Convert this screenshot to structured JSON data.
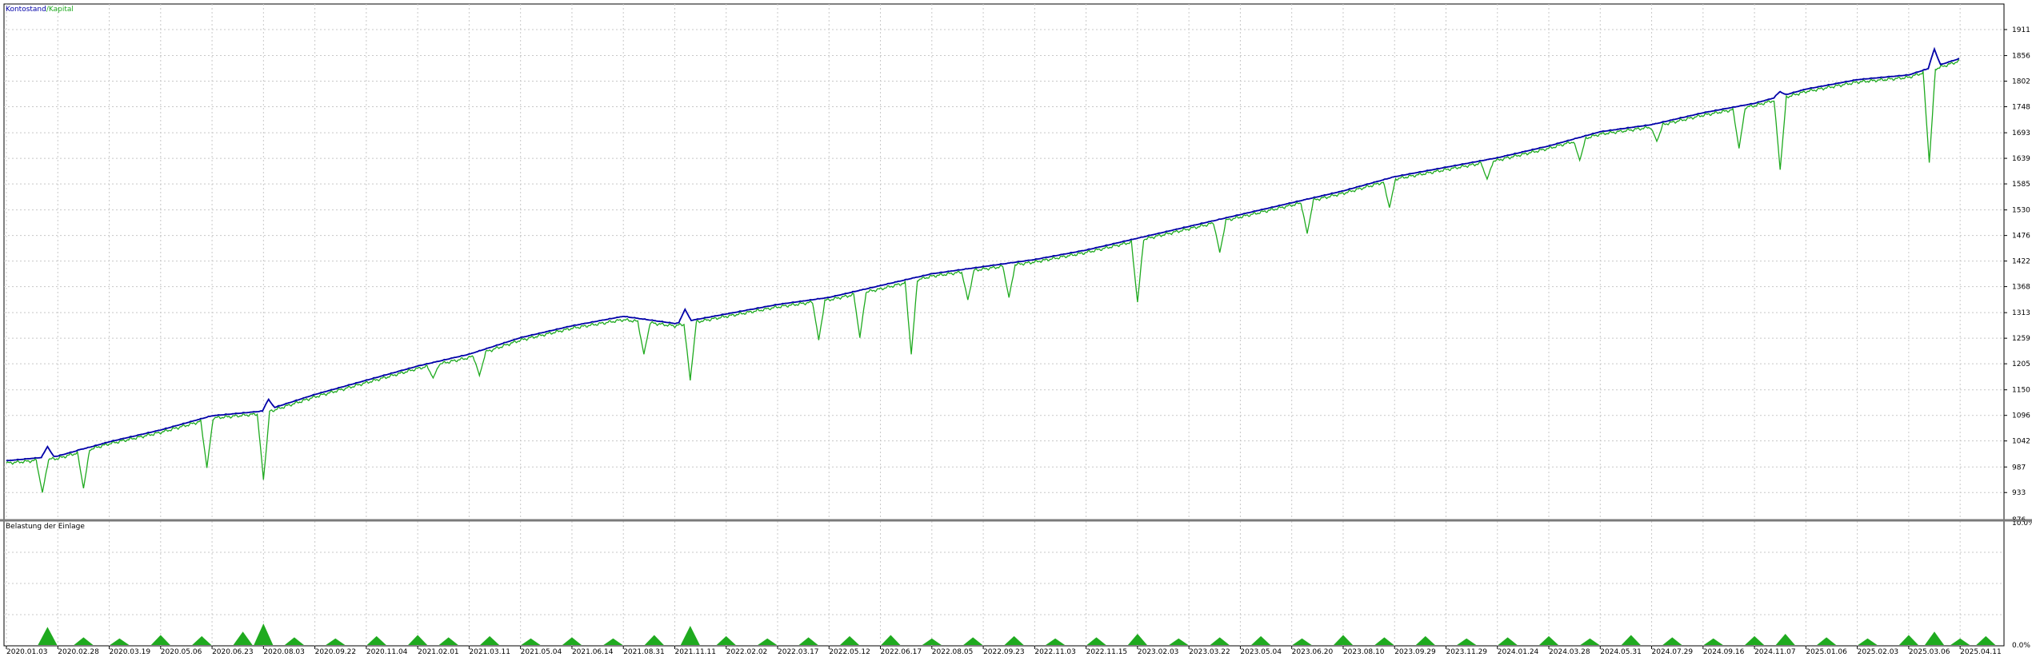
{
  "chart_data": [
    {
      "type": "line",
      "legend": [
        {
          "label": "Kontostand",
          "color": "#0000a8"
        },
        {
          "label": "Kapital",
          "color": "#1faa1f"
        }
      ],
      "legend_separator": " / ",
      "ylim": [
        876,
        1965
      ],
      "y_ticks": [
        876,
        933,
        987,
        1042,
        1096,
        1150,
        1205,
        1259,
        1313,
        1368,
        1422,
        1476,
        1530,
        1585,
        1639,
        1693,
        1748,
        1802,
        1856,
        1911
      ],
      "x_tick_labels": [
        "2020.01.03",
        "2020.02.28",
        "2020.03.19",
        "2020.05.06",
        "2020.06.23",
        "2020.08.03",
        "2020.09.22",
        "2020.11.04",
        "2021.02.01",
        "2021.03.11",
        "2021.05.04",
        "2021.06.14",
        "2021.08.31",
        "2021.11.11",
        "2022.02.02",
        "2022.03.17",
        "2022.05.12",
        "2022.06.17",
        "2022.08.05",
        "2022.09.23",
        "2022.11.03",
        "2022.11.15",
        "2023.02.03",
        "2023.03.22",
        "2023.05.04",
        "2023.06.20",
        "2023.08.10",
        "2023.09.29",
        "2023.11.29",
        "2024.01.24",
        "2024.03.28",
        "2024.05.31",
        "2024.07.29",
        "2024.09.16",
        "2024.11.07",
        "2025.01.06",
        "2025.02.03",
        "2025.03.06",
        "2025.04.11"
      ],
      "x": [
        0,
        1,
        2,
        3,
        4,
        5,
        6,
        7,
        8,
        9,
        10,
        11,
        12,
        13,
        14,
        15,
        16,
        17,
        18,
        19,
        20,
        21,
        22,
        23,
        24,
        25,
        26,
        27,
        28,
        29,
        30,
        31,
        32,
        33,
        34,
        35,
        36,
        37,
        38
      ],
      "series": [
        {
          "name": "Kontostand",
          "color": "#0000a8",
          "values": [
            1000,
            1010,
            1040,
            1065,
            1095,
            1105,
            1140,
            1170,
            1200,
            1225,
            1260,
            1285,
            1305,
            1290,
            1310,
            1330,
            1345,
            1370,
            1395,
            1410,
            1425,
            1445,
            1470,
            1495,
            1520,
            1545,
            1570,
            1600,
            1620,
            1640,
            1665,
            1695,
            1710,
            1735,
            1755,
            1785,
            1805,
            1815,
            1850
          ]
        },
        {
          "name": "Kapital",
          "color": "#1faa1f",
          "values": [
            995,
            1005,
            1036,
            1060,
            1090,
            1100,
            1135,
            1165,
            1195,
            1218,
            1255,
            1280,
            1298,
            1285,
            1305,
            1325,
            1340,
            1363,
            1390,
            1405,
            1420,
            1440,
            1465,
            1490,
            1515,
            1540,
            1565,
            1595,
            1615,
            1635,
            1660,
            1690,
            1705,
            1730,
            1750,
            1780,
            1800,
            1810,
            1845
          ]
        }
      ],
      "equity_dips": [
        {
          "x": 0.7,
          "low": 933
        },
        {
          "x": 1.5,
          "low": 942
        },
        {
          "x": 3.9,
          "low": 985
        },
        {
          "x": 5.0,
          "low": 960
        },
        {
          "x": 8.3,
          "low": 1175
        },
        {
          "x": 9.2,
          "low": 1180
        },
        {
          "x": 12.4,
          "low": 1225
        },
        {
          "x": 13.3,
          "low": 1170
        },
        {
          "x": 15.8,
          "low": 1255
        },
        {
          "x": 16.6,
          "low": 1260
        },
        {
          "x": 17.6,
          "low": 1225
        },
        {
          "x": 18.7,
          "low": 1340
        },
        {
          "x": 19.5,
          "low": 1345
        },
        {
          "x": 22.0,
          "low": 1335
        },
        {
          "x": 23.6,
          "low": 1440
        },
        {
          "x": 25.3,
          "low": 1480
        },
        {
          "x": 26.9,
          "low": 1535
        },
        {
          "x": 28.8,
          "low": 1595
        },
        {
          "x": 30.6,
          "low": 1635
        },
        {
          "x": 32.1,
          "low": 1675
        },
        {
          "x": 33.7,
          "low": 1660
        },
        {
          "x": 34.5,
          "low": 1615
        },
        {
          "x": 37.4,
          "low": 1630
        },
        {
          "x": 38.1,
          "low": 1705
        }
      ],
      "balance_spikes": [
        {
          "x": 0.8,
          "high": 1030
        },
        {
          "x": 1.5,
          "high": 1025
        },
        {
          "x": 5.1,
          "high": 1130
        },
        {
          "x": 13.2,
          "high": 1320
        },
        {
          "x": 15.4,
          "high": 1335
        },
        {
          "x": 17.9,
          "high": 1362
        },
        {
          "x": 22.0,
          "high": 1465
        },
        {
          "x": 34.5,
          "high": 1780
        },
        {
          "x": 37.5,
          "high": 1870
        },
        {
          "x": 37.9,
          "high": 1825
        },
        {
          "x": 38.5,
          "high": 1858
        }
      ]
    },
    {
      "type": "area",
      "title": "Belastung der Einlage",
      "color": "#1faa1f",
      "y_tick_labels": [
        "10.0%",
        "0.0%"
      ],
      "ylim": [
        0,
        10
      ],
      "x": [
        0.8,
        1.5,
        2.2,
        3.0,
        3.8,
        4.6,
        5.0,
        5.6,
        6.4,
        7.2,
        8.0,
        8.6,
        9.4,
        10.2,
        11.0,
        11.8,
        12.6,
        13.3,
        14.0,
        14.8,
        15.6,
        16.4,
        17.2,
        18.0,
        18.8,
        19.6,
        20.4,
        21.2,
        22.0,
        22.8,
        23.6,
        24.4,
        25.2,
        26.0,
        26.8,
        27.6,
        28.4,
        29.2,
        30.0,
        30.8,
        31.6,
        32.4,
        33.2,
        34.0,
        34.6,
        35.4,
        36.2,
        37.0,
        37.5,
        38.0,
        38.5
      ],
      "values": [
        1.5,
        0.6,
        0.5,
        0.8,
        0.7,
        1.1,
        1.8,
        0.6,
        0.5,
        0.7,
        0.8,
        0.6,
        0.7,
        0.5,
        0.6,
        0.5,
        0.8,
        1.6,
        0.7,
        0.5,
        0.6,
        0.7,
        0.8,
        0.5,
        0.6,
        0.7,
        0.5,
        0.6,
        0.9,
        0.5,
        0.6,
        0.7,
        0.5,
        0.8,
        0.6,
        0.7,
        0.5,
        0.6,
        0.7,
        0.5,
        0.8,
        0.6,
        0.5,
        0.7,
        0.9,
        0.6,
        0.5,
        0.8,
        1.1,
        0.5,
        0.7
      ]
    }
  ]
}
